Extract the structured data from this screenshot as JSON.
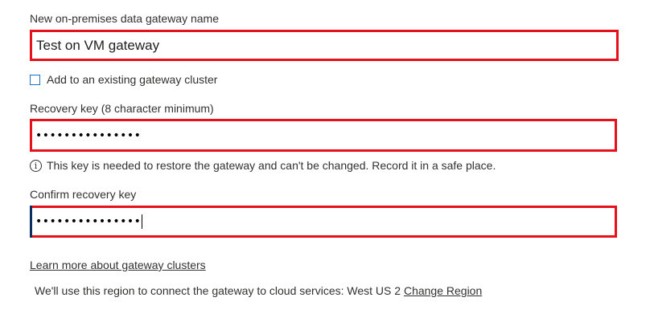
{
  "gateway_name": {
    "label": "New on-premises data gateway name",
    "value": "Test on VM gateway"
  },
  "existing_cluster": {
    "label": "Add to an existing gateway cluster",
    "checked": false
  },
  "recovery_key": {
    "label": "Recovery key (8 character minimum)",
    "masked_value": "•••••••••••••••"
  },
  "info": {
    "icon": "info-icon",
    "icon_glyph": "i",
    "text": "This key is needed to restore the gateway and can't be changed. Record it in a safe place."
  },
  "confirm_key": {
    "label": "Confirm recovery key",
    "masked_value": "•••••••••••••••"
  },
  "learn_more": {
    "text": "Learn more about gateway clusters"
  },
  "region": {
    "text": "We'll use this region to connect the gateway to cloud services: West US 2",
    "change_link": "Change Region"
  },
  "colors": {
    "highlight_border": "#e8111b",
    "checkbox_border": "#1a73c8",
    "text": "#323130"
  }
}
